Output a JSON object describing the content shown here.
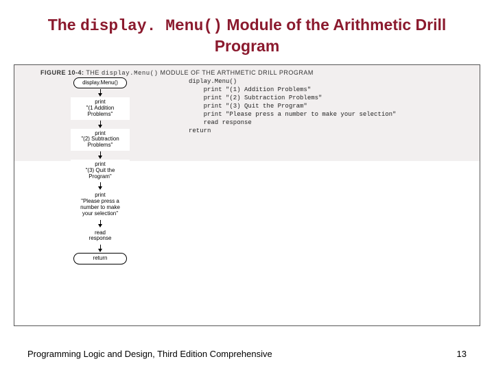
{
  "title_pre": "The ",
  "title_code": "display. Menu()",
  "title_post": " Module of the Arithmetic Drill Program",
  "figure_label": "FIGURE 10-4:",
  "figure_caption_pre": " THE ",
  "figure_caption_code": "display.Menu()",
  "figure_caption_post": " MODULE OF THE ARTHMETIC DRILL PROGRAM",
  "pseudo_lines": "diplay.Menu()\n    print \"(1) Addition Problems\"\n    print \"(2) Subtraction Problems\"\n    print \"(3) Quit the Program\"\n    print \"Please press a number to make your selection\"\n    read response\nreturn",
  "flow": {
    "start": "display.Menu()",
    "s1": "print\n\"(1 Addition\nProblems\"",
    "s2": "print\n\"(2) Subtraction\nProblems\"",
    "s3": "print\n\"(3) Quit the\nProgram\"",
    "s4": "print\n\"Please press a\nnumber to make\nyour selection\"",
    "s5": "read\nresponse",
    "end": "return"
  },
  "footer_left": "Programming Logic and Design, Third Edition Comprehensive",
  "footer_right": "13"
}
